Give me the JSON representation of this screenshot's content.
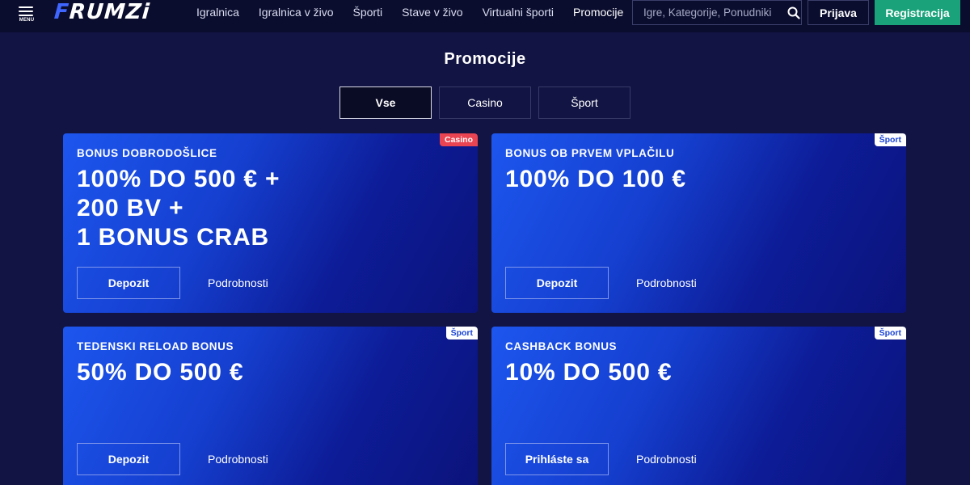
{
  "header": {
    "menu_label": "MENU",
    "logo_text": "FRUMZI",
    "nav": [
      "Igralnica",
      "Igralnica v živo",
      "Športi",
      "Stave v živo",
      "Virtualni športi",
      "Promocije"
    ],
    "active_nav": "Promocije",
    "search_placeholder": "Igre, Kategorije, Ponudniki",
    "login_label": "Prijava",
    "register_label": "Registracija"
  },
  "page": {
    "title": "Promocije",
    "filters": [
      "Vse",
      "Casino",
      "Šport"
    ],
    "active_filter": "Vse"
  },
  "promotions": [
    {
      "badge": "Casino",
      "subtitle": "BONUS DOBRODOŠLICE",
      "headline": "100% DO 500 € +\n200 BV +\n1 BONUS CRAB",
      "button": "Depozit",
      "link": "Podrobnosti"
    },
    {
      "badge": "Šport",
      "subtitle": "BONUS OB PRVEM VPLAČILU",
      "headline": "100% DO 100 €",
      "button": "Depozit",
      "link": "Podrobnosti"
    },
    {
      "badge": "Šport",
      "subtitle": "TEDENSKI RELOAD BONUS",
      "headline": "50% DO 500 €",
      "button": "Depozit",
      "link": "Podrobnosti"
    },
    {
      "badge": "Šport",
      "subtitle": "CASHBACK BONUS",
      "headline": "10% DO 500 €",
      "button": "Prihláste sa",
      "link": "Podrobnosti"
    }
  ],
  "colors": {
    "page_bg": "#121443",
    "header_bg": "#0b0d2e",
    "logo_accent": "#3f66ff",
    "register_green": "#1aa37a",
    "casino_badge": "#e94451",
    "sport_badge_text": "#1a43d6",
    "card_gradient_start": "#1d56ee",
    "card_gradient_end": "#0b137a"
  },
  "icons": {
    "menu": "hamburger-icon",
    "search": "search-icon"
  }
}
